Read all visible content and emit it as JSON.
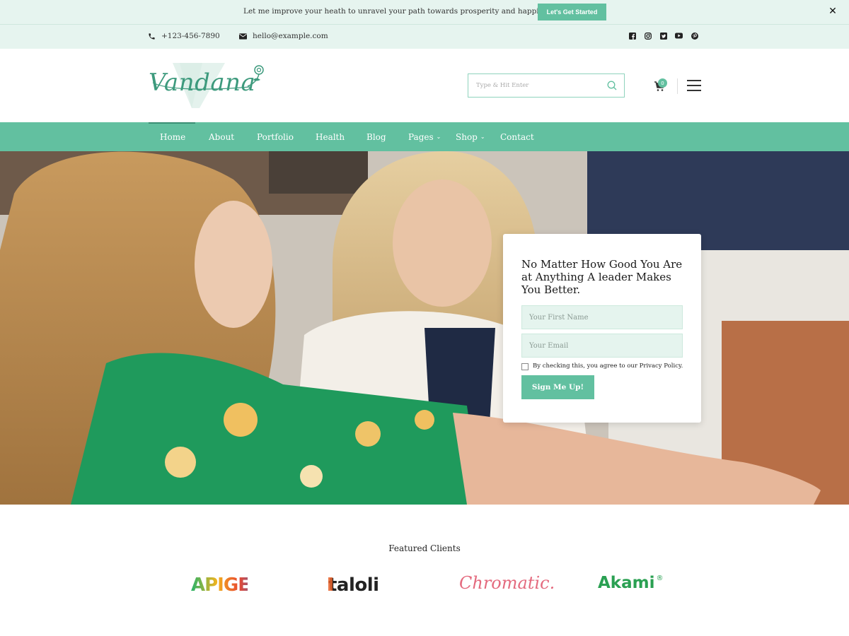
{
  "announcement": {
    "text": "Let me improve your heath to unravel your path towards prosperity and happiness.",
    "button_label": "Let's Get Started",
    "close_icon": "close-icon"
  },
  "contact": {
    "phone": "+123-456-7890",
    "email": "hello@example.com",
    "socials": [
      "facebook-icon",
      "instagram-icon",
      "twitter-icon",
      "youtube-icon",
      "pinterest-icon"
    ]
  },
  "header": {
    "logo_text": "Vandana",
    "search_placeholder": "Type & Hit Enter",
    "cart_count": "0"
  },
  "nav": {
    "items": [
      {
        "label": "Home"
      },
      {
        "label": "About"
      },
      {
        "label": "Portfolio"
      },
      {
        "label": "Health"
      },
      {
        "label": "Blog"
      },
      {
        "label": "Pages",
        "dropdown": true
      },
      {
        "label": "Shop",
        "dropdown": true
      },
      {
        "label": "Contact"
      }
    ],
    "active": "Home"
  },
  "hero": {
    "form": {
      "title": "No Matter How Good You Are at Anything A leader Makes You Better.",
      "first_name_placeholder": "Your First Name",
      "email_placeholder": "Your Email",
      "consent_label": "By checking this, you agree to our Privacy Policy.",
      "submit_label": "Sign Me Up!"
    }
  },
  "featured": {
    "title": "Featured Clients",
    "clients": [
      "APIGEO",
      "taloli",
      "Chromatic.",
      "Akami"
    ]
  },
  "colors": {
    "accent": "#62c0a0",
    "light_bg": "#e6f4ef",
    "logo": "#3d9a7d"
  }
}
